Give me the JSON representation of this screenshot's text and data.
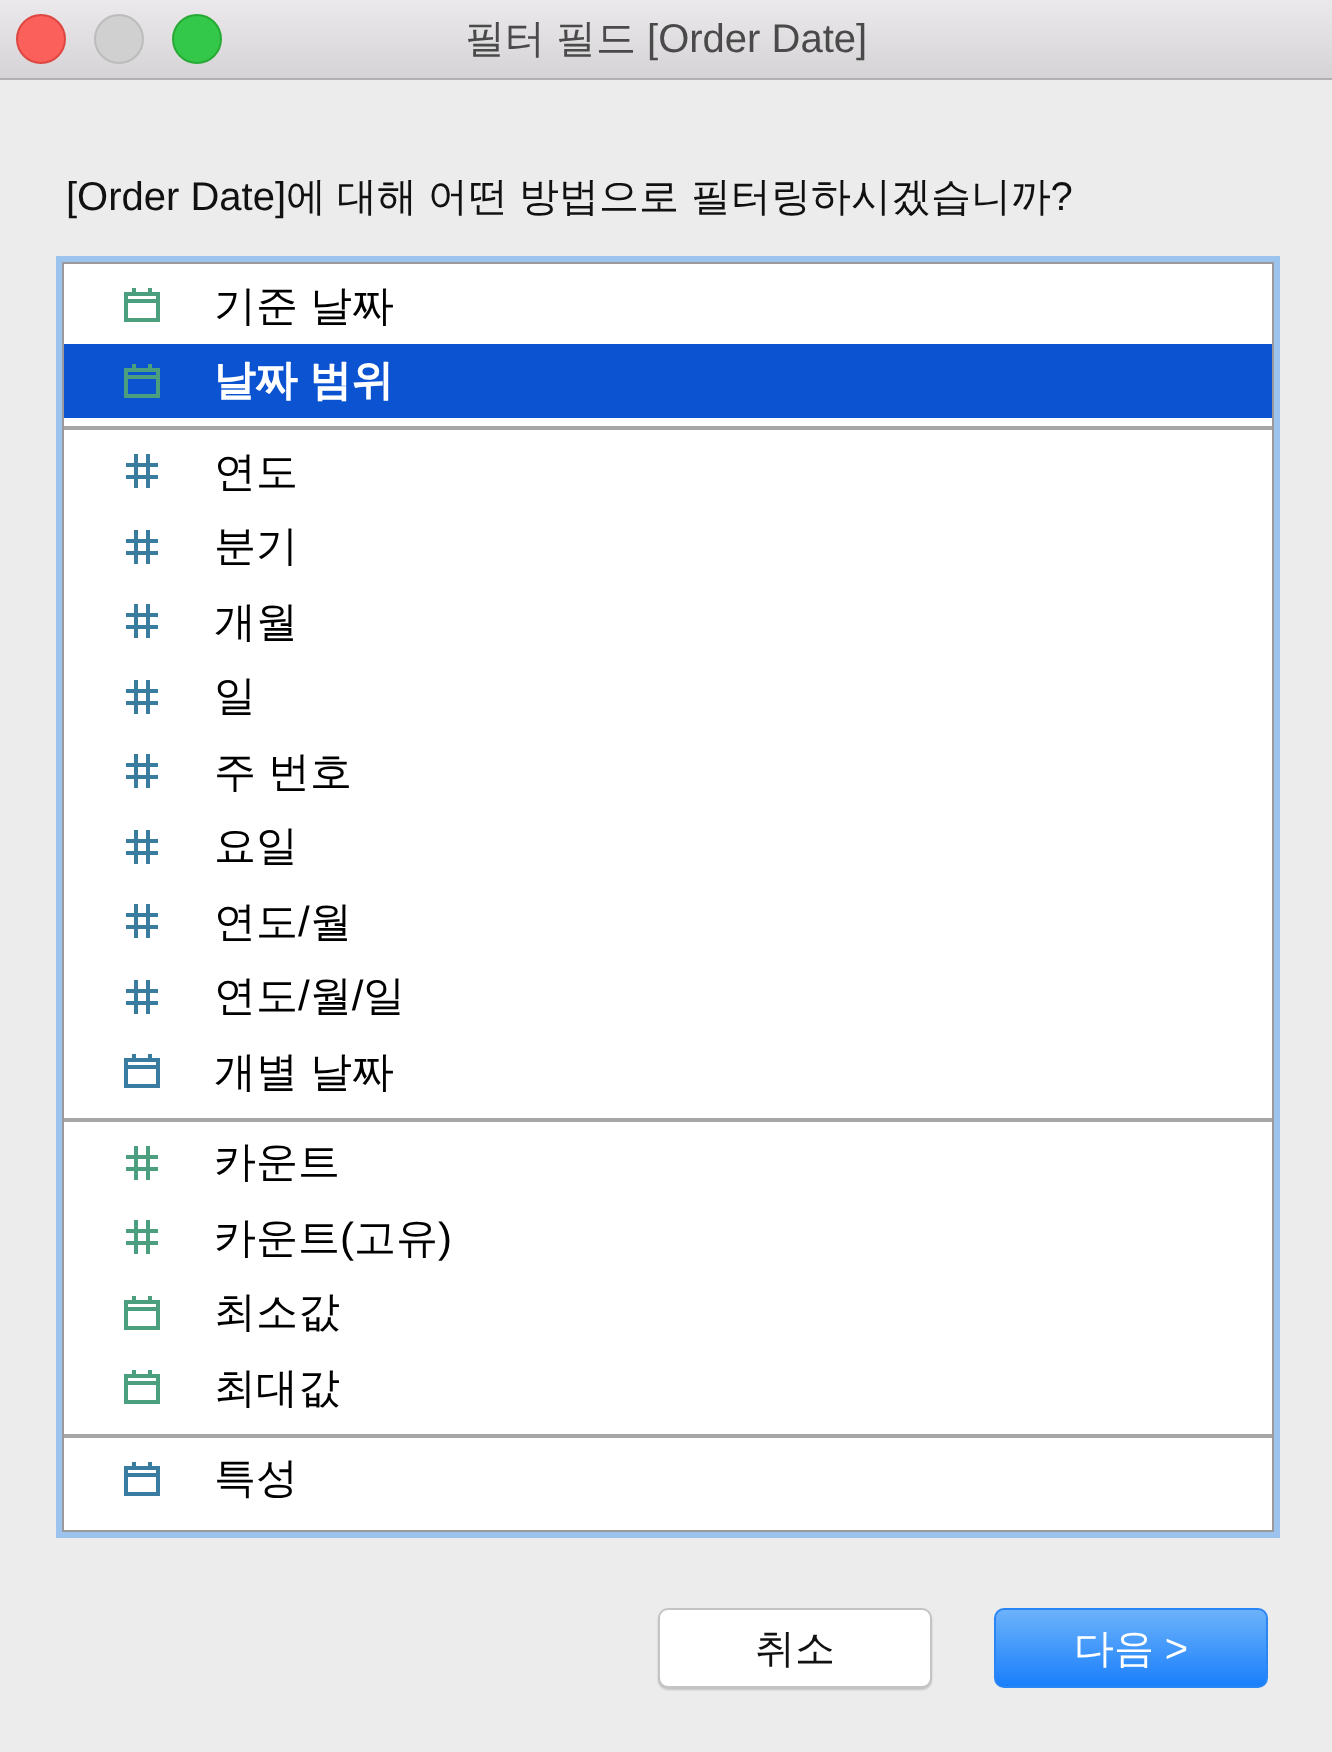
{
  "window": {
    "title": "필터 필드 [Order Date]",
    "controls": [
      {
        "kind": "close",
        "disabled": false
      },
      {
        "kind": "minimize",
        "disabled": true
      },
      {
        "kind": "zoom",
        "disabled": false
      }
    ]
  },
  "prompt": "[Order Date]에 대해 어떤 방법으로 필터링하시겠습니까?",
  "options": {
    "groups": [
      {
        "items": [
          {
            "label": "기준 날짜",
            "kind": "calendar",
            "color": "#4b9e7e",
            "selected": false
          },
          {
            "label": "날짜 범위",
            "kind": "calendar",
            "color": "#4b9e7e",
            "selected": true
          }
        ]
      },
      {
        "items": [
          {
            "label": "연도",
            "kind": "hash",
            "color": "#3a7ba0",
            "selected": false
          },
          {
            "label": "분기",
            "kind": "hash",
            "color": "#3a7ba0",
            "selected": false
          },
          {
            "label": "개월",
            "kind": "hash",
            "color": "#3a7ba0",
            "selected": false
          },
          {
            "label": "일",
            "kind": "hash",
            "color": "#3a7ba0",
            "selected": false
          },
          {
            "label": "주 번호",
            "kind": "hash",
            "color": "#3a7ba0",
            "selected": false
          },
          {
            "label": "요일",
            "kind": "hash",
            "color": "#3a7ba0",
            "selected": false
          },
          {
            "label": "연도/월",
            "kind": "hash",
            "color": "#3a7ba0",
            "selected": false
          },
          {
            "label": "연도/월/일",
            "kind": "hash",
            "color": "#3a7ba0",
            "selected": false
          },
          {
            "label": "개별 날짜",
            "kind": "calendar",
            "color": "#3a7ba0",
            "selected": false
          }
        ]
      },
      {
        "items": [
          {
            "label": "카운트",
            "kind": "hash",
            "color": "#4b9e7e",
            "selected": false
          },
          {
            "label": "카운트(고유)",
            "kind": "hash",
            "color": "#4b9e7e",
            "selected": false
          },
          {
            "label": "최소값",
            "kind": "calendar",
            "color": "#4b9e7e",
            "selected": false
          },
          {
            "label": "최대값",
            "kind": "calendar",
            "color": "#4b9e7e",
            "selected": false
          }
        ]
      },
      {
        "items": [
          {
            "label": "특성",
            "kind": "calendar",
            "color": "#3a7ba0",
            "selected": false
          }
        ]
      }
    ]
  },
  "buttons": [
    {
      "label": "취소",
      "kind": "default"
    },
    {
      "label": "다음 >",
      "kind": "primary"
    }
  ]
}
